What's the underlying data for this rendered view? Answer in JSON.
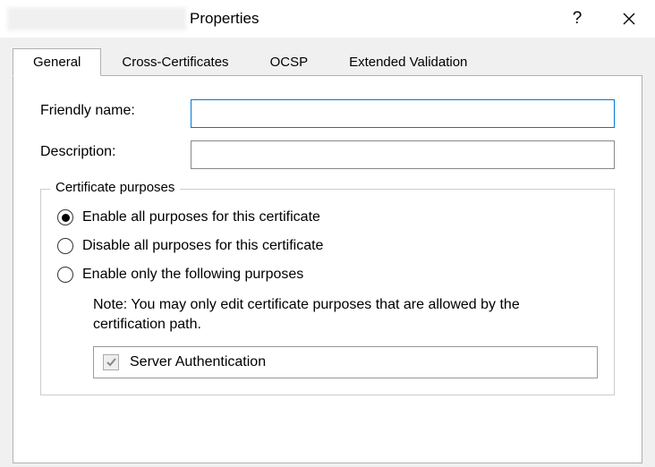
{
  "window": {
    "title": "Properties"
  },
  "tabs": {
    "general": "General",
    "cross": "Cross-Certificates",
    "ocsp": "OCSP",
    "ev": "Extended Validation"
  },
  "general": {
    "friendly_name_label": "Friendly name:",
    "friendly_name_value": "",
    "description_label": "Description:",
    "description_value": "",
    "purposes_legend": "Certificate purposes",
    "radio_enable_all": "Enable all purposes for this certificate",
    "radio_disable_all": "Disable all purposes for this certificate",
    "radio_enable_only": "Enable only the following purposes",
    "note": "Note: You may only edit certificate purposes that are allowed by the certification path.",
    "purposes": [
      {
        "label": "Server Authentication",
        "checked": true
      }
    ]
  }
}
